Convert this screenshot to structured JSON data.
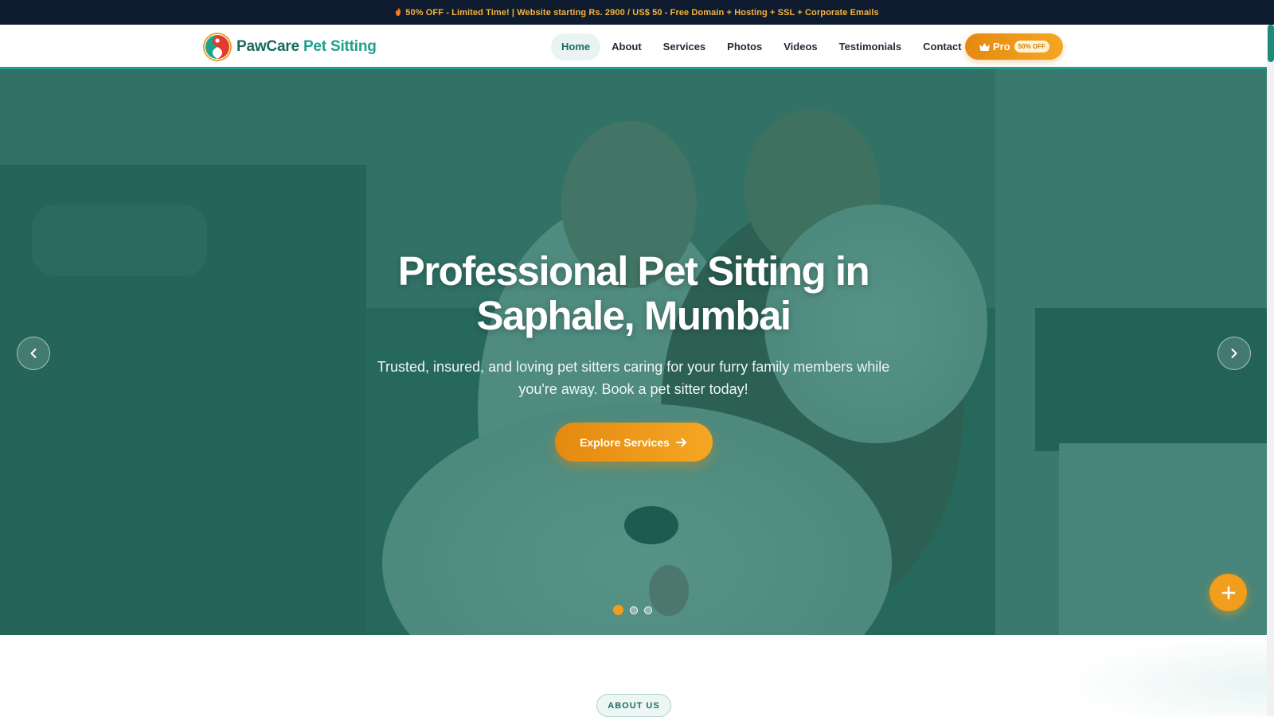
{
  "promo": {
    "text": "50% OFF - Limited Time! | Website starting Rs. 2900 / US$ 50 - Free Domain + Hosting + SSL + Corporate Emails",
    "icon": "fire-icon"
  },
  "brand": {
    "name_part1": "PawCare",
    "name_part2": " Pet Sitting",
    "logo_icon": "pawcare-logo"
  },
  "nav": {
    "items": [
      {
        "label": "Home",
        "active": true
      },
      {
        "label": "About"
      },
      {
        "label": "Services"
      },
      {
        "label": "Photos"
      },
      {
        "label": "Videos"
      },
      {
        "label": "Testimonials"
      },
      {
        "label": "Contact"
      }
    ],
    "pro_label": "Pro",
    "pro_badge": "50% OFF"
  },
  "hero": {
    "title": "Professional Pet Sitting in Saphale, Mumbai",
    "subtitle": "Trusted, insured, and loving pet sitters caring for your furry family members while you're away. Book a pet sitter today!",
    "cta_label": "Explore Services",
    "slide_count": 3,
    "active_slide": 1
  },
  "about": {
    "pill_label": "ABOUT US"
  },
  "colors": {
    "primary": "#1fa08a",
    "dark_teal": "#166a60",
    "accent": "#f29d1c",
    "promo_bg": "#0f1b2e",
    "promo_text": "#f6b33c"
  }
}
